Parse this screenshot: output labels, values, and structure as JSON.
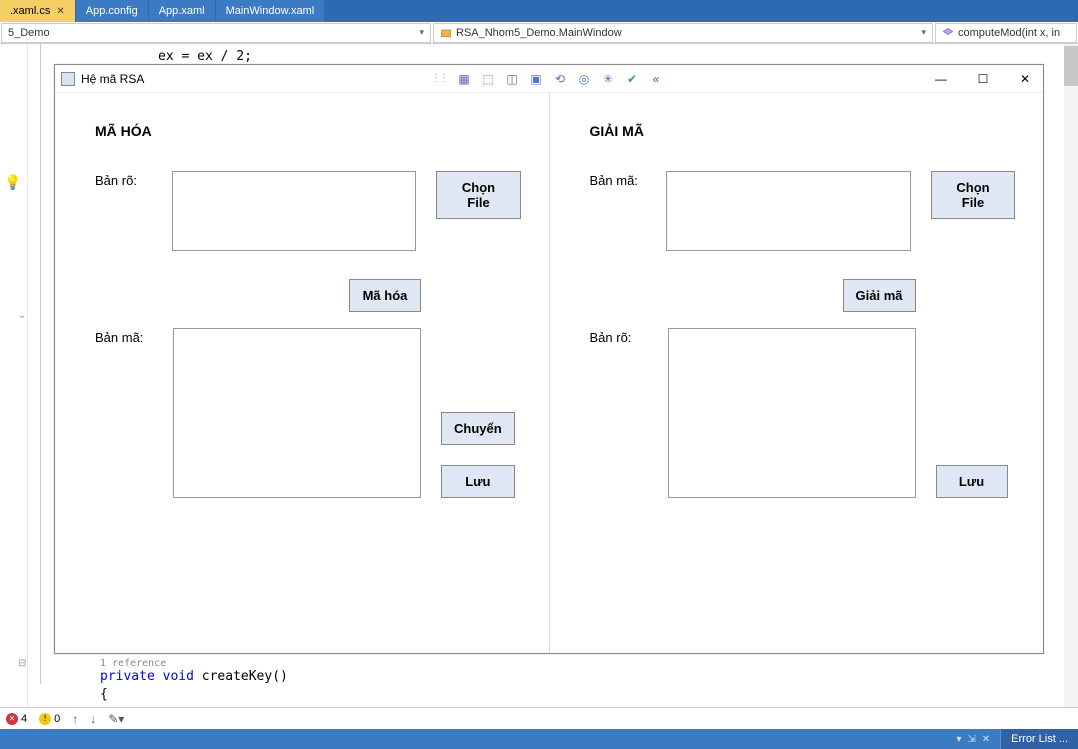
{
  "tabs": [
    {
      "label": ".xaml.cs",
      "active": true
    },
    {
      "label": "App.config",
      "active": false
    },
    {
      "label": "App.xaml",
      "active": false
    },
    {
      "label": "MainWindow.xaml",
      "active": false
    }
  ],
  "nav": {
    "left": "5_Demo",
    "middle": "RSA_Nhom5_Demo.MainWindow",
    "right": "computeMod(int x, in"
  },
  "code": {
    "line_top": "ex = ex / 2;",
    "ref_comment": "1 reference",
    "line_sig_kw1": "private",
    "line_sig_kw2": "void",
    "line_sig_name": " createKey()",
    "line_brace": "{"
  },
  "designer": {
    "title": "Hệ mã RSA",
    "encode": {
      "heading": "MÃ HÓA",
      "plaintext_label": "Bản rõ:",
      "ciphertext_label": "Bản mã:",
      "choose_file": "Chọn File",
      "encode_btn": "Mã hóa",
      "transfer_btn": "Chuyển",
      "save_btn": "Lưu"
    },
    "decode": {
      "heading": "GIẢI MÃ",
      "ciphertext_label": "Bản mã:",
      "plaintext_label": "Bản rõ:",
      "choose_file": "Chọn File",
      "decode_btn": "Giải mã",
      "save_btn": "Lưu"
    }
  },
  "status": {
    "errors": "4",
    "warnings": "0"
  },
  "footer": {
    "error_list": "Error List ..."
  }
}
